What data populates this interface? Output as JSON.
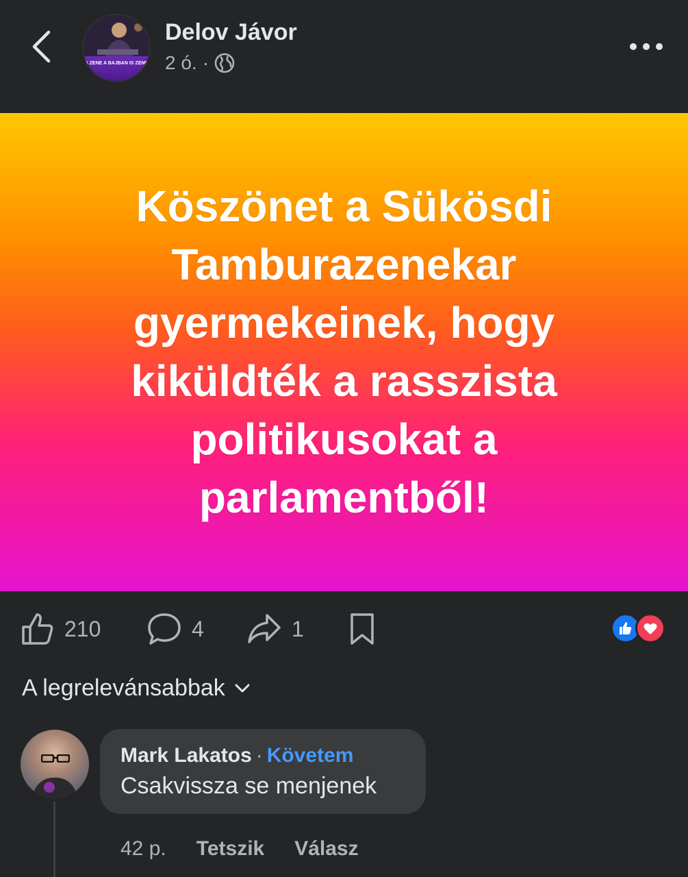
{
  "header": {
    "author": "Delov Jávor",
    "time": "2 ó.",
    "separator": "·",
    "avatar_caption": "A ZENE A BAJBAN IS ZENE"
  },
  "post": {
    "text": "Köszönet a Sükösdi Tamburazenekar gyermekeinek, hogy kiküldték a rasszista politikusokat a parlamentből!",
    "background": [
      "#ffc700",
      "#ff8c00",
      "#ff1f7a",
      "#e414d0"
    ]
  },
  "actions": {
    "likes": "210",
    "comments": "4",
    "shares": "1"
  },
  "reactions": [
    "like-icon",
    "love-icon"
  ],
  "sort": {
    "label": "A legrelevánsabbak"
  },
  "comment": {
    "author": "Mark Lakatos",
    "separator": "·",
    "follow": "Követem",
    "text": "Csakvissza se menjenek",
    "time": "42 p.",
    "like_label": "Tetszik",
    "reply_label": "Válasz"
  },
  "colors": {
    "background": "#242526",
    "text": "#e4e6eb",
    "muted": "#b0b3b8",
    "accent": "#4599ff",
    "like": "#1877f2",
    "love": "#f33e58"
  }
}
